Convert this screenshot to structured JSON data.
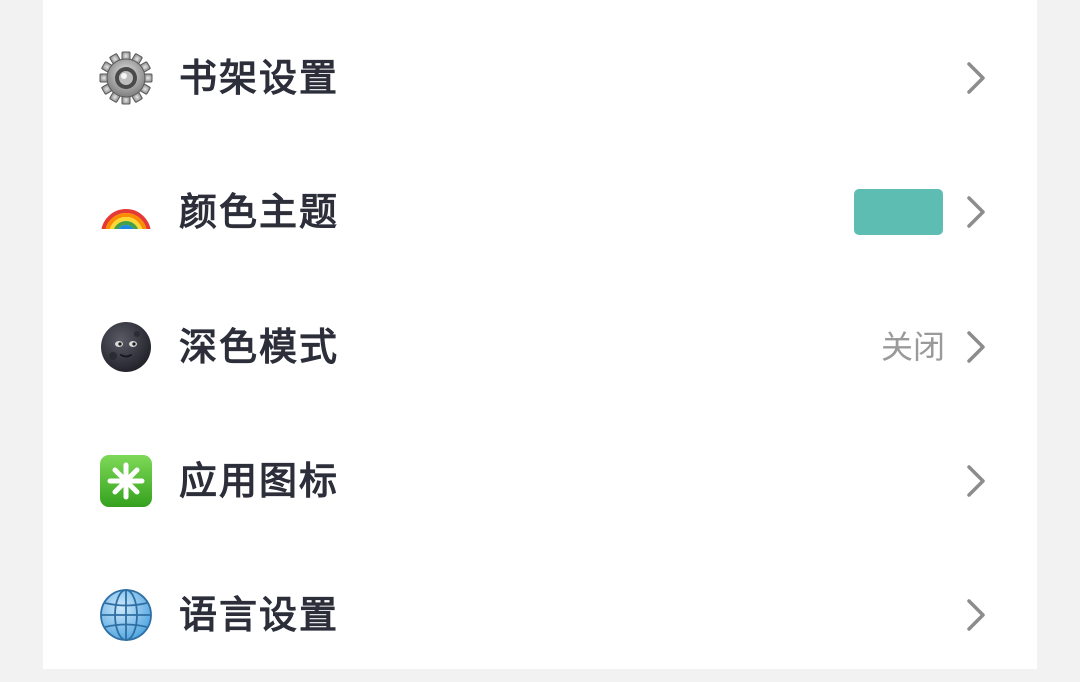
{
  "settings": {
    "accent_color": "#5dbdb2",
    "items": [
      {
        "label": "书架设置",
        "icon": "gear-icon"
      },
      {
        "label": "颜色主题",
        "icon": "rainbow-icon",
        "swatch_color": "#5dbdb2"
      },
      {
        "label": "深色模式",
        "icon": "new-moon-face-icon",
        "value": "关闭"
      },
      {
        "label": "应用图标",
        "icon": "eight-spoked-asterisk-icon"
      },
      {
        "label": "语言设置",
        "icon": "globe-icon"
      }
    ]
  }
}
